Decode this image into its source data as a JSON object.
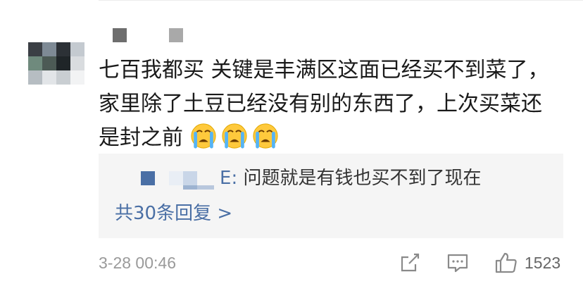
{
  "comment": {
    "text_line1": "七百我都买 关键是丰满区这面已经买不到菜了，",
    "text_line2": "家里除了土豆已经没有别的东西了，上次买菜还",
    "text_line3": "是封之前",
    "emoji": [
      "crying-face-emoji",
      "crying-face-emoji",
      "crying-face-emoji"
    ]
  },
  "reply": {
    "author_suffix": "E",
    "separator": ":",
    "text": " 问题就是有钱也买不到了现在",
    "view_all_label": "共30条回复 >"
  },
  "meta": {
    "timestamp": "3-28 00:46",
    "like_count": "1523",
    "icons": [
      "share-icon",
      "comment-icon",
      "like-icon"
    ]
  },
  "colors": {
    "link": "#4a6fa5",
    "text": "#1a1a1a",
    "muted": "#9a9a9a",
    "reply_bg": "#f5f5f5"
  }
}
